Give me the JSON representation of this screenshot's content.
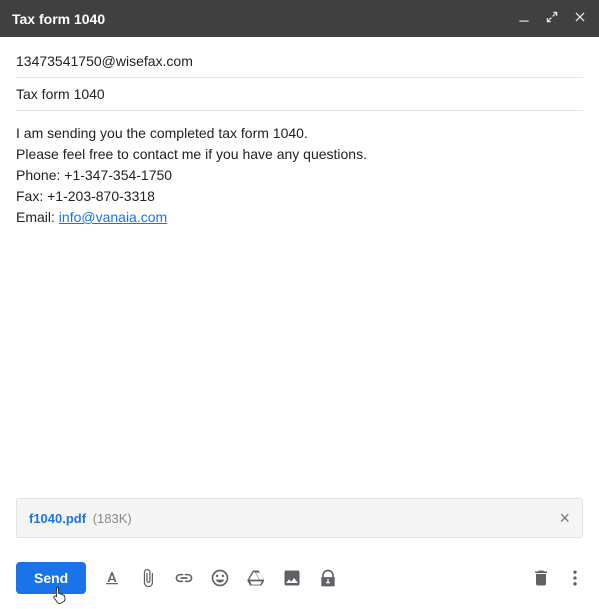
{
  "window": {
    "title": "Tax form 1040"
  },
  "to": "13473541750@wisefax.com",
  "subject": "Tax form 1040",
  "body": {
    "line1": "I am sending you the completed tax form 1040.",
    "line2": "Please feel free to contact me if you have any questions.",
    "phone_label": "Phone: ",
    "phone": "+1-347-354-1750",
    "fax_label": "Fax: ",
    "fax": "+1-203-870-3318",
    "email_label": "Email: ",
    "email_link": "info@vanaia.com"
  },
  "attachment": {
    "name": "f1040.pdf",
    "size": "(183K)"
  },
  "actions": {
    "send_label": "Send"
  }
}
